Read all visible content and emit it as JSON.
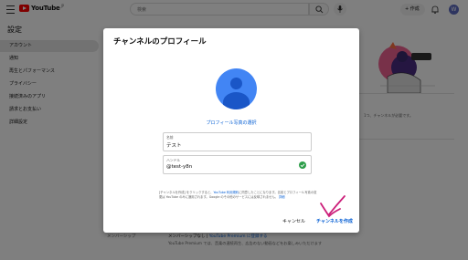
{
  "header": {
    "logo_text": "YouTube",
    "logo_sup": "JP",
    "search_placeholder": "検索",
    "create_label": "作成",
    "avatar_initial": "W"
  },
  "sidebar": {
    "title": "設定",
    "items": [
      {
        "label": "アカウント",
        "active": true
      },
      {
        "label": "通知"
      },
      {
        "label": "再生とパフォーマンス"
      },
      {
        "label": "プライバシー"
      },
      {
        "label": "接続済みのアプリ"
      },
      {
        "label": "請求とお支払い"
      },
      {
        "label": "詳細設定"
      }
    ]
  },
  "background": {
    "t1": "アカ",
    "t2": "Yo",
    "t3": "addi",
    "t4": "Yo",
    "t5": "これ",
    "t6": "チャ",
    "t7": "ア",
    "t8": "Goog",
    "t9": "Goo",
    "t10": "ファ",
    "t11": "メンバーシップ",
    "right_note": "1つ、チャンネルが必要です。",
    "membership_line1_a": "メンバーシップなし | ",
    "membership_line1_link": "YouTube Premium に登録する",
    "membership_line2": "YouTube Premium では、音楽の連続再生、広告のない動画などをお楽しみいただけます"
  },
  "dialog": {
    "title": "チャンネルのプロフィール",
    "select_picture": "プロフィール写真の選択",
    "name_label": "名前",
    "name_value": "テスト",
    "handle_label": "ハンドル",
    "handle_value": "@test-y8n",
    "fineprint": "[チャンネルを作成] をクリックすると、",
    "fineprint_link": "YouTube 利用規約",
    "fineprint_rest": "に同意したことになります。名前とプロフィール写真の変更は YouTube のみに適用されます。Google のその他のサービスには反映されません。",
    "fineprint_more": "詳細",
    "cancel_label": "キャンセル",
    "create_label": "チャンネルを作成"
  },
  "colors": {
    "accent": "#065fd4",
    "brand": "#ff0000",
    "annotation": "#cc1f7a",
    "avatar_bg": "#4285f4",
    "check": "#2e9e4a"
  }
}
